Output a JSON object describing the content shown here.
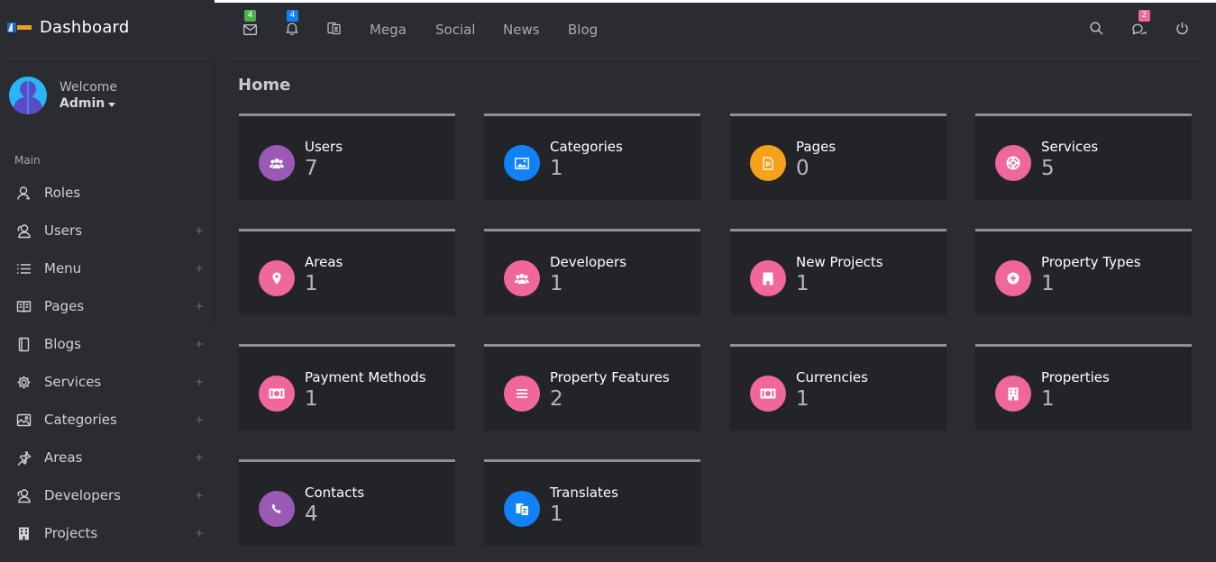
{
  "brand": {
    "title": "Dashboard"
  },
  "user": {
    "greeting": "Welcome",
    "name": "Admin"
  },
  "sidebar": {
    "section": "Main",
    "items": [
      {
        "label": "Roles",
        "icon": "user-icon",
        "expandable": false
      },
      {
        "label": "Users",
        "icon": "users-icon",
        "expandable": true
      },
      {
        "label": "Menu",
        "icon": "list-icon",
        "expandable": true
      },
      {
        "label": "Pages",
        "icon": "book-icon",
        "expandable": true
      },
      {
        "label": "Blogs",
        "icon": "tablet-icon",
        "expandable": true
      },
      {
        "label": "Services",
        "icon": "gear-icon",
        "expandable": true
      },
      {
        "label": "Categories",
        "icon": "image-icon",
        "expandable": true
      },
      {
        "label": "Areas",
        "icon": "pin-icon",
        "expandable": true
      },
      {
        "label": "Developers",
        "icon": "users-icon",
        "expandable": true
      },
      {
        "label": "Projects",
        "icon": "building-icon",
        "expandable": true
      }
    ],
    "expand_symbol": "+"
  },
  "topbar": {
    "mail_badge": "4",
    "bell_badge": "4",
    "links": [
      "Mega",
      "Social",
      "News",
      "Blog"
    ],
    "chat_badge": "2"
  },
  "page": {
    "title": "Home"
  },
  "cards": [
    {
      "title": "Users",
      "value": "7",
      "color": "#9b59b6",
      "icon": "users-icon"
    },
    {
      "title": "Categories",
      "value": "1",
      "color": "#1182f5",
      "icon": "image-icon"
    },
    {
      "title": "Pages",
      "value": "0",
      "color": "#f7a11a",
      "icon": "document-icon"
    },
    {
      "title": "Services",
      "value": "5",
      "color": "#f0679b",
      "icon": "lifebuoy-icon"
    },
    {
      "title": "Areas",
      "value": "1",
      "color": "#f0679b",
      "icon": "pin-icon"
    },
    {
      "title": "Developers",
      "value": "1",
      "color": "#f0679b",
      "icon": "users-icon"
    },
    {
      "title": "New Projects",
      "value": "1",
      "color": "#f0679b",
      "icon": "building-icon"
    },
    {
      "title": "Property Types",
      "value": "1",
      "color": "#f0679b",
      "icon": "plus-circle-icon"
    },
    {
      "title": "Payment Methods",
      "value": "1",
      "color": "#f0679b",
      "icon": "money-icon"
    },
    {
      "title": "Property Features",
      "value": "2",
      "color": "#f0679b",
      "icon": "list-icon"
    },
    {
      "title": "Currencies",
      "value": "1",
      "color": "#f0679b",
      "icon": "money-icon"
    },
    {
      "title": "Properties",
      "value": "1",
      "color": "#f0679b",
      "icon": "building-icon"
    },
    {
      "title": "Contacts",
      "value": "4",
      "color": "#9b59b6",
      "icon": "phone-icon"
    },
    {
      "title": "Translates",
      "value": "1",
      "color": "#1182f5",
      "icon": "translate-icon"
    }
  ],
  "colors": {
    "badge_green": "#4caf50",
    "badge_blue": "#1182f5",
    "badge_pink": "#f0679b"
  }
}
